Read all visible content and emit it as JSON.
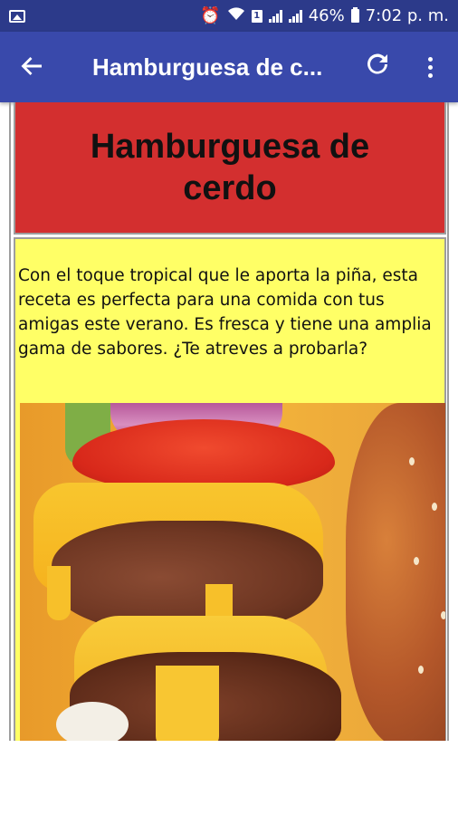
{
  "status_bar": {
    "battery_percent": "46%",
    "time": "7:02 p. m.",
    "sim_label": "1",
    "icons": [
      "image-icon",
      "alarm-icon",
      "wifi-icon",
      "sim-icon",
      "signal-icon",
      "signal-icon",
      "battery-icon"
    ]
  },
  "app_bar": {
    "title": "Hamburguesa de c...",
    "back_icon": "arrow-back-icon",
    "refresh_icon": "refresh-icon",
    "menu_icon": "more-vert-icon"
  },
  "recipe": {
    "title": "Hamburguesa de cerdo",
    "description": "Con el toque tropical que le aporta la piña, esta receta es perfecta para una comida con tus amigas este verano. Es fresca y tiene una amplia gama de sabores. ¿Te atreves a probarla?",
    "colors": {
      "title_bg": "#d32f2f",
      "description_bg": "#ffff66"
    }
  },
  "theme": {
    "status_bar_color": "#2c3a8a",
    "app_bar_color": "#3949ab"
  }
}
